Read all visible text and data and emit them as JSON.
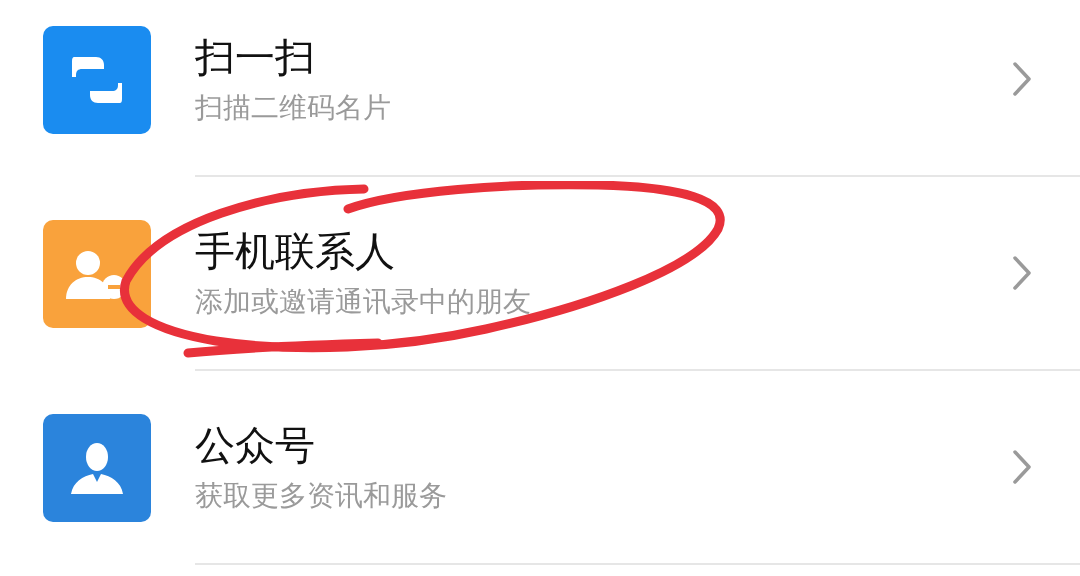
{
  "items": [
    {
      "kind": "scan",
      "color": "#1a8cf0",
      "title": "扫一扫",
      "subtitle": "扫描二维码名片",
      "circled": false
    },
    {
      "kind": "contacts",
      "color": "#f9a23c",
      "title": "手机联系人",
      "subtitle": "添加或邀请通讯录中的朋友",
      "circled": true
    },
    {
      "kind": "official",
      "color": "#2b84dc",
      "title": "公众号",
      "subtitle": "获取更多资讯和服务",
      "circled": false
    }
  ]
}
